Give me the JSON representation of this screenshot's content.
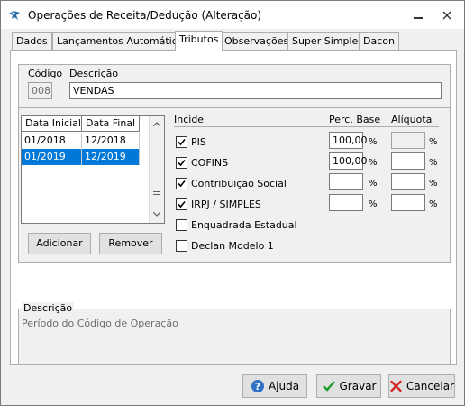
{
  "window": {
    "title": "Operações de Receita/Dedução (Alteração)",
    "accent": "#0078d7"
  },
  "tabs": [
    {
      "label": "Dados",
      "active": false
    },
    {
      "label": "Lançamentos Automáticos",
      "active": false
    },
    {
      "label": "Tributos",
      "active": true
    },
    {
      "label": "Observações",
      "active": false
    },
    {
      "label": "Super Simples",
      "active": false
    },
    {
      "label": "Dacon",
      "active": false
    }
  ],
  "form": {
    "codigo_label": "Código",
    "codigo_value": "008",
    "descricao_label": "Descrição",
    "descricao_value": "VENDAS"
  },
  "periods": {
    "columns": [
      "Data Inicial",
      "Data Final"
    ],
    "rows": [
      {
        "inicial": "01/2018",
        "final": "12/2018",
        "selected": false
      },
      {
        "inicial": "01/2019",
        "final": "12/2019",
        "selected": true
      }
    ],
    "add_label": "Adicionar",
    "remove_label": "Remover"
  },
  "taxes": {
    "header_incide": "Incide",
    "header_perc": "Perc. Base",
    "header_aliquota": "Alíquota",
    "pct_symbol": "%",
    "items": [
      {
        "label": "PIS",
        "checked": true,
        "perc": "100,00",
        "aliquota": ""
      },
      {
        "label": "COFINS",
        "checked": true,
        "perc": "100,00",
        "aliquota": ""
      },
      {
        "label": "Contribuição Social",
        "checked": true,
        "perc": "",
        "aliquota": ""
      },
      {
        "label": "IRPJ / SIMPLES",
        "checked": true,
        "perc": "",
        "aliquota": ""
      }
    ],
    "extra_checks": [
      {
        "label": "Enquadrada Estadual",
        "checked": false
      },
      {
        "label": "Declan Modelo 1",
        "checked": false
      }
    ]
  },
  "description_box": {
    "title": "Descrição",
    "text": "Período do Código de Operação"
  },
  "footer": {
    "help_label": "Ajuda",
    "save_label": "Gravar",
    "cancel_label": "Cancelar"
  }
}
